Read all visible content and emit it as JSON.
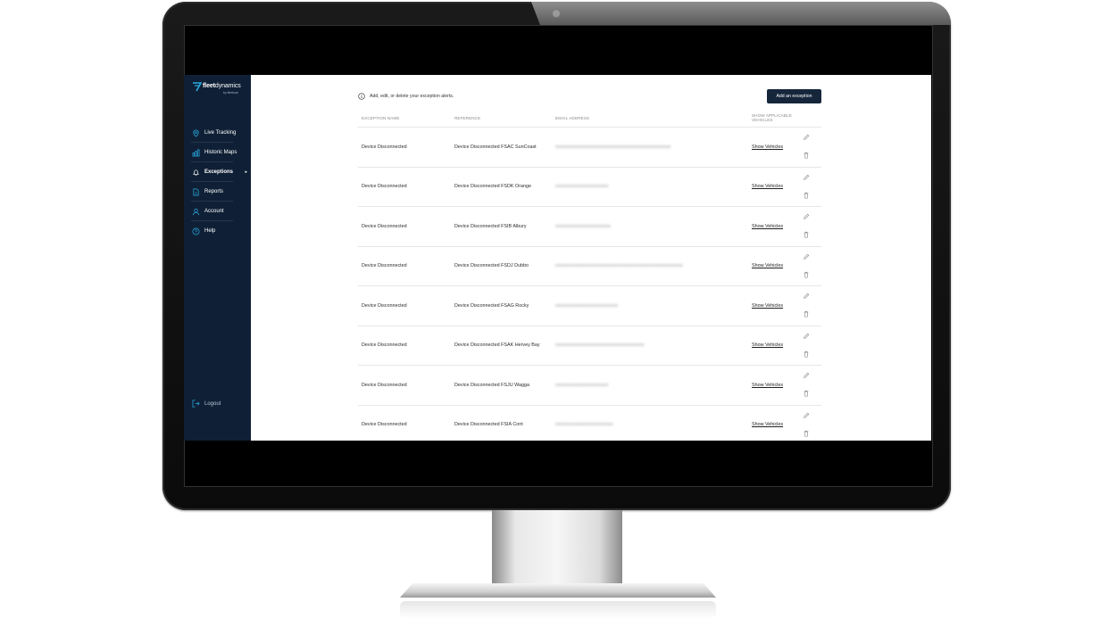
{
  "brand": {
    "name_bold": "fleet",
    "name_light": "dynamics",
    "sub": "by fleetuse"
  },
  "sidebar": {
    "items": [
      {
        "label": "Live Tracking",
        "icon": "location-pin-icon",
        "active": false
      },
      {
        "label": "Historic Maps",
        "icon": "chart-icon",
        "active": false
      },
      {
        "label": "Exceptions",
        "icon": "bell-icon",
        "active": true
      },
      {
        "label": "Reports",
        "icon": "document-icon",
        "active": false
      },
      {
        "label": "Account",
        "icon": "user-icon",
        "active": false
      },
      {
        "label": "Help",
        "icon": "help-icon",
        "active": false
      }
    ],
    "logout": "Logout"
  },
  "main": {
    "info_text": "Add, edit, or delete your exception alerts.",
    "add_button": "Add an exception"
  },
  "table": {
    "headers": {
      "name": "Exception Name",
      "reference": "Reference",
      "email": "Email Address",
      "show": "Show Applicable Vehicles"
    },
    "rows": [
      {
        "name": "Device Disconnected",
        "reference": "Device Disconnected FSAC SunCoast",
        "email": "xxxxxxxxxxxxxxxxxxxxxxxxxxxxxxxxxxxxxxxxxxxxxxxx",
        "show": "Show Vehicles"
      },
      {
        "name": "Device Disconnected",
        "reference": "Device Disconnected FSDK Orange",
        "email": "xxxxxxxxxxxxxxxxxxxxxx",
        "show": "Show Vehicles"
      },
      {
        "name": "Device Disconnected",
        "reference": "Device Disconnected FSIB Albury",
        "email": "xxxxxxxxxxxxxxxxxxxxxxx",
        "show": "Show Vehicles"
      },
      {
        "name": "Device Disconnected",
        "reference": "Device Disconnected FSDJ Dubbo",
        "email": "xxxxxxxxxxxxxxxxxxxxxxxxxxxxxxxxxxxxxxxxxxxxxxxxxxxxx",
        "show": "Show Vehicles"
      },
      {
        "name": "Device Disconnected",
        "reference": "Device Disconnected FSAG Rocky",
        "email": "xxxxxxxxxxxxxxxxxxxxxxxxxx",
        "show": "Show Vehicles"
      },
      {
        "name": "Device Disconnected",
        "reference": "Device Disconnected FSAK Hervey Bay",
        "email": "xxxxxxxxxxxxxxxxxxxxxxxxxxxxxxxxxxxxx",
        "show": "Show Vehicles"
      },
      {
        "name": "Device Disconnected",
        "reference": "Device Disconnected FSJU Wagga",
        "email": "xxxxxxxxxxxxxxxxxxxxxx",
        "show": "Show Vehicles"
      },
      {
        "name": "Device Disconnected",
        "reference": "Device Disconnected FSIA Cont",
        "email": "xxxxxxxxxxxxxxxxxxxxxxxx",
        "show": "Show Vehicles"
      }
    ]
  },
  "colors": {
    "sidebar_bg": "#0f2036",
    "accent": "#29a8e0",
    "button_bg": "#15263b"
  }
}
